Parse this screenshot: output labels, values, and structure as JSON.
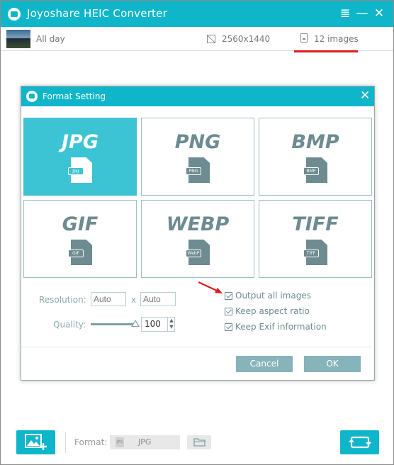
{
  "app": {
    "title": "Joyoshare HEIC Converter"
  },
  "window_controls": {
    "menu": "≣",
    "minimize": "—",
    "close": "✕"
  },
  "infobar": {
    "name": "All day",
    "resolution": "2560x1440",
    "images": "12 images"
  },
  "dialog": {
    "title": "Format Setting",
    "close": "✕",
    "formats": [
      {
        "name": "JPG",
        "tag": "Jpg",
        "selected": true
      },
      {
        "name": "PNG",
        "tag": "PNG",
        "selected": false
      },
      {
        "name": "BMP",
        "tag": "BMP",
        "selected": false
      },
      {
        "name": "GIF",
        "tag": "GIF",
        "selected": false
      },
      {
        "name": "WEBP",
        "tag": "WebP",
        "selected": false
      },
      {
        "name": "TIFF",
        "tag": "TIFF",
        "selected": false
      }
    ],
    "resolution": {
      "label": "Resolution:",
      "width_placeholder": "Auto",
      "separator": "x",
      "height_placeholder": "Auto"
    },
    "quality": {
      "label": "Quality:",
      "value": "100",
      "level": 1.0
    },
    "options": [
      {
        "label": "Output all images",
        "checked": true
      },
      {
        "label": "Keep aspect ratio",
        "checked": true
      },
      {
        "label": "Keep Exif information",
        "checked": true
      }
    ],
    "cancel_label": "Cancel",
    "ok_label": "OK"
  },
  "bottom": {
    "format_label": "Format:",
    "format_tag": "JPG",
    "format_value": "JPG"
  },
  "colors": {
    "accent": "#0fb6c9",
    "selected_tile": "#3dc4d4",
    "annotation": "#e0181c"
  }
}
